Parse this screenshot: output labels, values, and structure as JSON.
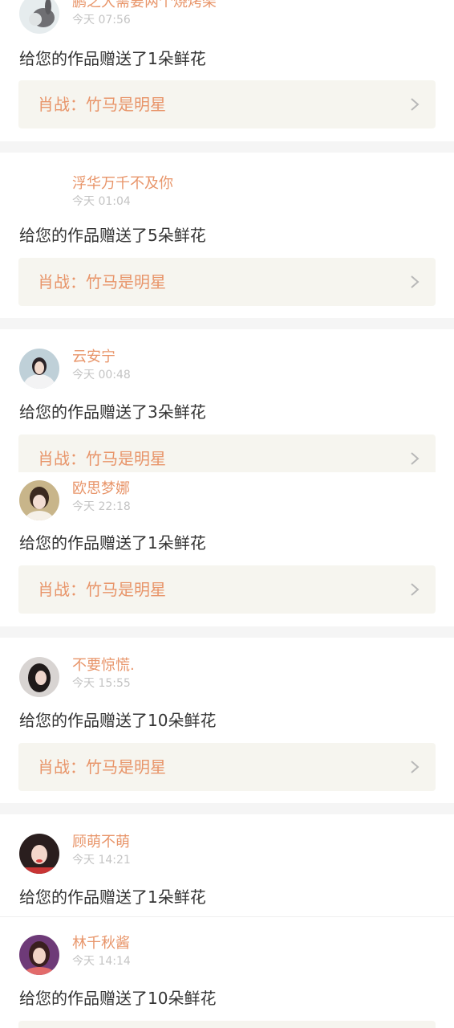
{
  "colors": {
    "accent": "#e8956a",
    "work_bg": "#f6f5ef",
    "gap_bg": "#f5f5f5",
    "time": "#c4c4c4",
    "text": "#333333"
  },
  "notifications": [
    {
      "user": "鹏之大需要两个烧烤架",
      "time": "今天 07:56",
      "message": "给您的作品赠送了1朵鲜花",
      "work": "肖战：竹马是明星"
    },
    {
      "user": "浮华万千不及你",
      "time": "今天 01:04",
      "message": "给您的作品赠送了5朵鲜花",
      "work": "肖战：竹马是明星"
    },
    {
      "user": "云安宁",
      "time": "今天 00:48",
      "message": "给您的作品赠送了3朵鲜花",
      "work": "肖战：竹马是明星"
    },
    {
      "user": "欧思梦娜",
      "time": "今天 22:18",
      "message": "给您的作品赠送了1朵鲜花",
      "work": "肖战：竹马是明星"
    },
    {
      "user": "不要惊慌.",
      "time": "今天 15:55",
      "message": "给您的作品赠送了10朵鲜花",
      "work": "肖战：竹马是明星"
    },
    {
      "user": "顾萌不萌",
      "time": "今天 14:21",
      "message": "给您的作品赠送了1朵鲜花"
    },
    {
      "user": "林千秋酱",
      "time": "今天 14:14",
      "message": "给您的作品赠送了10朵鲜花"
    }
  ]
}
